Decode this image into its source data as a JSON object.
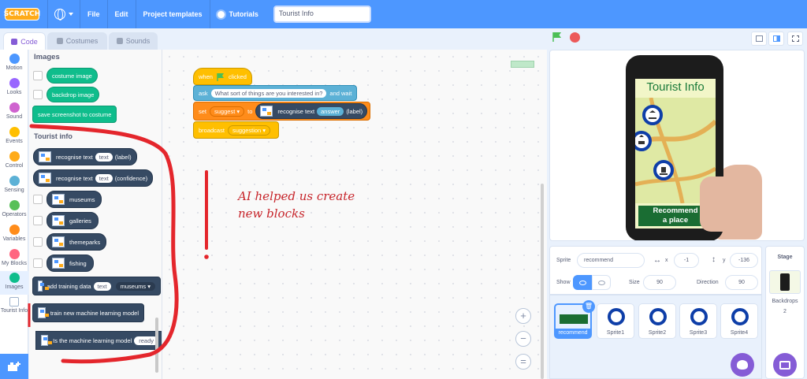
{
  "menu": {
    "logo": "SCRATCH",
    "file": "File",
    "edit": "Edit",
    "project_templates": "Project templates",
    "tutorials": "Tutorials",
    "project_title": "Tourist Info"
  },
  "tabs": {
    "code": "Code",
    "costumes": "Costumes",
    "sounds": "Sounds"
  },
  "categories": [
    {
      "label": "Motion",
      "color": "#4c97ff"
    },
    {
      "label": "Looks",
      "color": "#9966ff"
    },
    {
      "label": "Sound",
      "color": "#cf63cf"
    },
    {
      "label": "Events",
      "color": "#ffbf00"
    },
    {
      "label": "Control",
      "color": "#ffab19"
    },
    {
      "label": "Sensing",
      "color": "#5cb1d6"
    },
    {
      "label": "Operators",
      "color": "#59c059"
    },
    {
      "label": "Variables",
      "color": "#ff8c1a"
    },
    {
      "label": "My Blocks",
      "color": "#ff6680"
    },
    {
      "label": "Images",
      "color": "#0fbd8c"
    },
    {
      "label": "Tourist Info",
      "color": "#364a63"
    }
  ],
  "palette": {
    "images_title": "Images",
    "costume_image": "costume image",
    "backdrop_image": "backdrop image",
    "save_screenshot": "save screenshot to costume",
    "tourist_title": "Tourist info",
    "recognise_label": {
      "pre": "recognise text",
      "slot": "text",
      "post": "(label)"
    },
    "recognise_conf": {
      "pre": "recognise text",
      "slot": "text",
      "post": "(confidence)"
    },
    "labels": [
      "museums",
      "galleries",
      "themeparks",
      "fishing"
    ],
    "add_training": {
      "pre": "add training data",
      "slot": "text",
      "dd": "museums"
    },
    "train_model": "train new machine learning model",
    "is_ready": {
      "pre": "Is the machine learning model",
      "post": "ready"
    }
  },
  "script": {
    "hat": {
      "when": "when",
      "clicked": "clicked"
    },
    "ask": {
      "ask": "ask",
      "question": "What sort of things are you interested in?",
      "wait": "and wait"
    },
    "set": {
      "set": "set",
      "var": "suggest",
      "to": "to",
      "recognise": "recognise text",
      "answer": "answer",
      "label": "(label)"
    },
    "broadcast": {
      "broadcast": "broadcast",
      "msg": "suggestion"
    }
  },
  "annotation": "AI helped us create new blocks",
  "stage": {
    "phone_title": "Tourist Info",
    "recommend_l1": "Recommend",
    "recommend_l2": "a place"
  },
  "sprite_info": {
    "sprite_label": "Sprite",
    "sprite_name": "recommend",
    "x_label": "x",
    "x": "-1",
    "y_label": "y",
    "y": "-136",
    "show_label": "Show",
    "size_label": "Size",
    "size": "90",
    "direction_label": "Direction",
    "direction": "90"
  },
  "sprites": [
    "recommend",
    "Sprite1",
    "Sprite2",
    "Sprite3",
    "Sprite4"
  ],
  "stage_panel": {
    "title": "Stage",
    "backdrops_label": "Backdrops",
    "backdrops_count": "2"
  }
}
